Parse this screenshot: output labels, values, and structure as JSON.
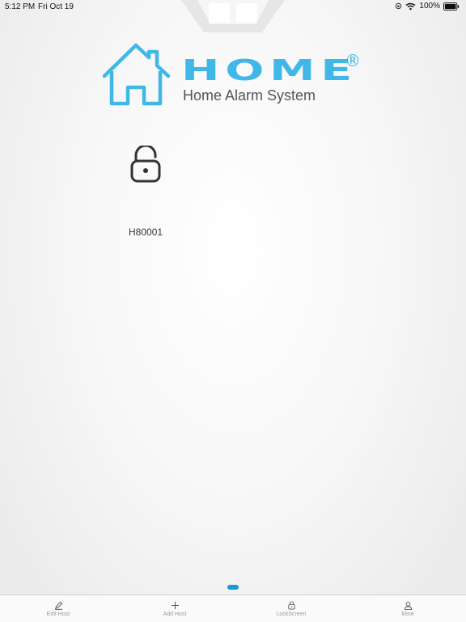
{
  "status_bar": {
    "time": "5:12 PM",
    "date": "Fri Oct 19",
    "battery": "100%"
  },
  "logo": {
    "word": "HOME",
    "registered": "®",
    "subtitle": "Home Alarm System",
    "color": "#3fb8e8"
  },
  "host": {
    "name": "H80001",
    "lock_icon": "unlocked-padlock-icon"
  },
  "pager": {
    "pages": 1,
    "current": 1,
    "color": "#1a9ad6"
  },
  "tab_bar": {
    "items": [
      {
        "label": "Edit Host",
        "icon": "pencil-icon"
      },
      {
        "label": "Add Host",
        "icon": "plus-icon"
      },
      {
        "label": "LockScreen",
        "icon": "lock-icon"
      },
      {
        "label": "Mine",
        "icon": "person-icon"
      }
    ]
  }
}
